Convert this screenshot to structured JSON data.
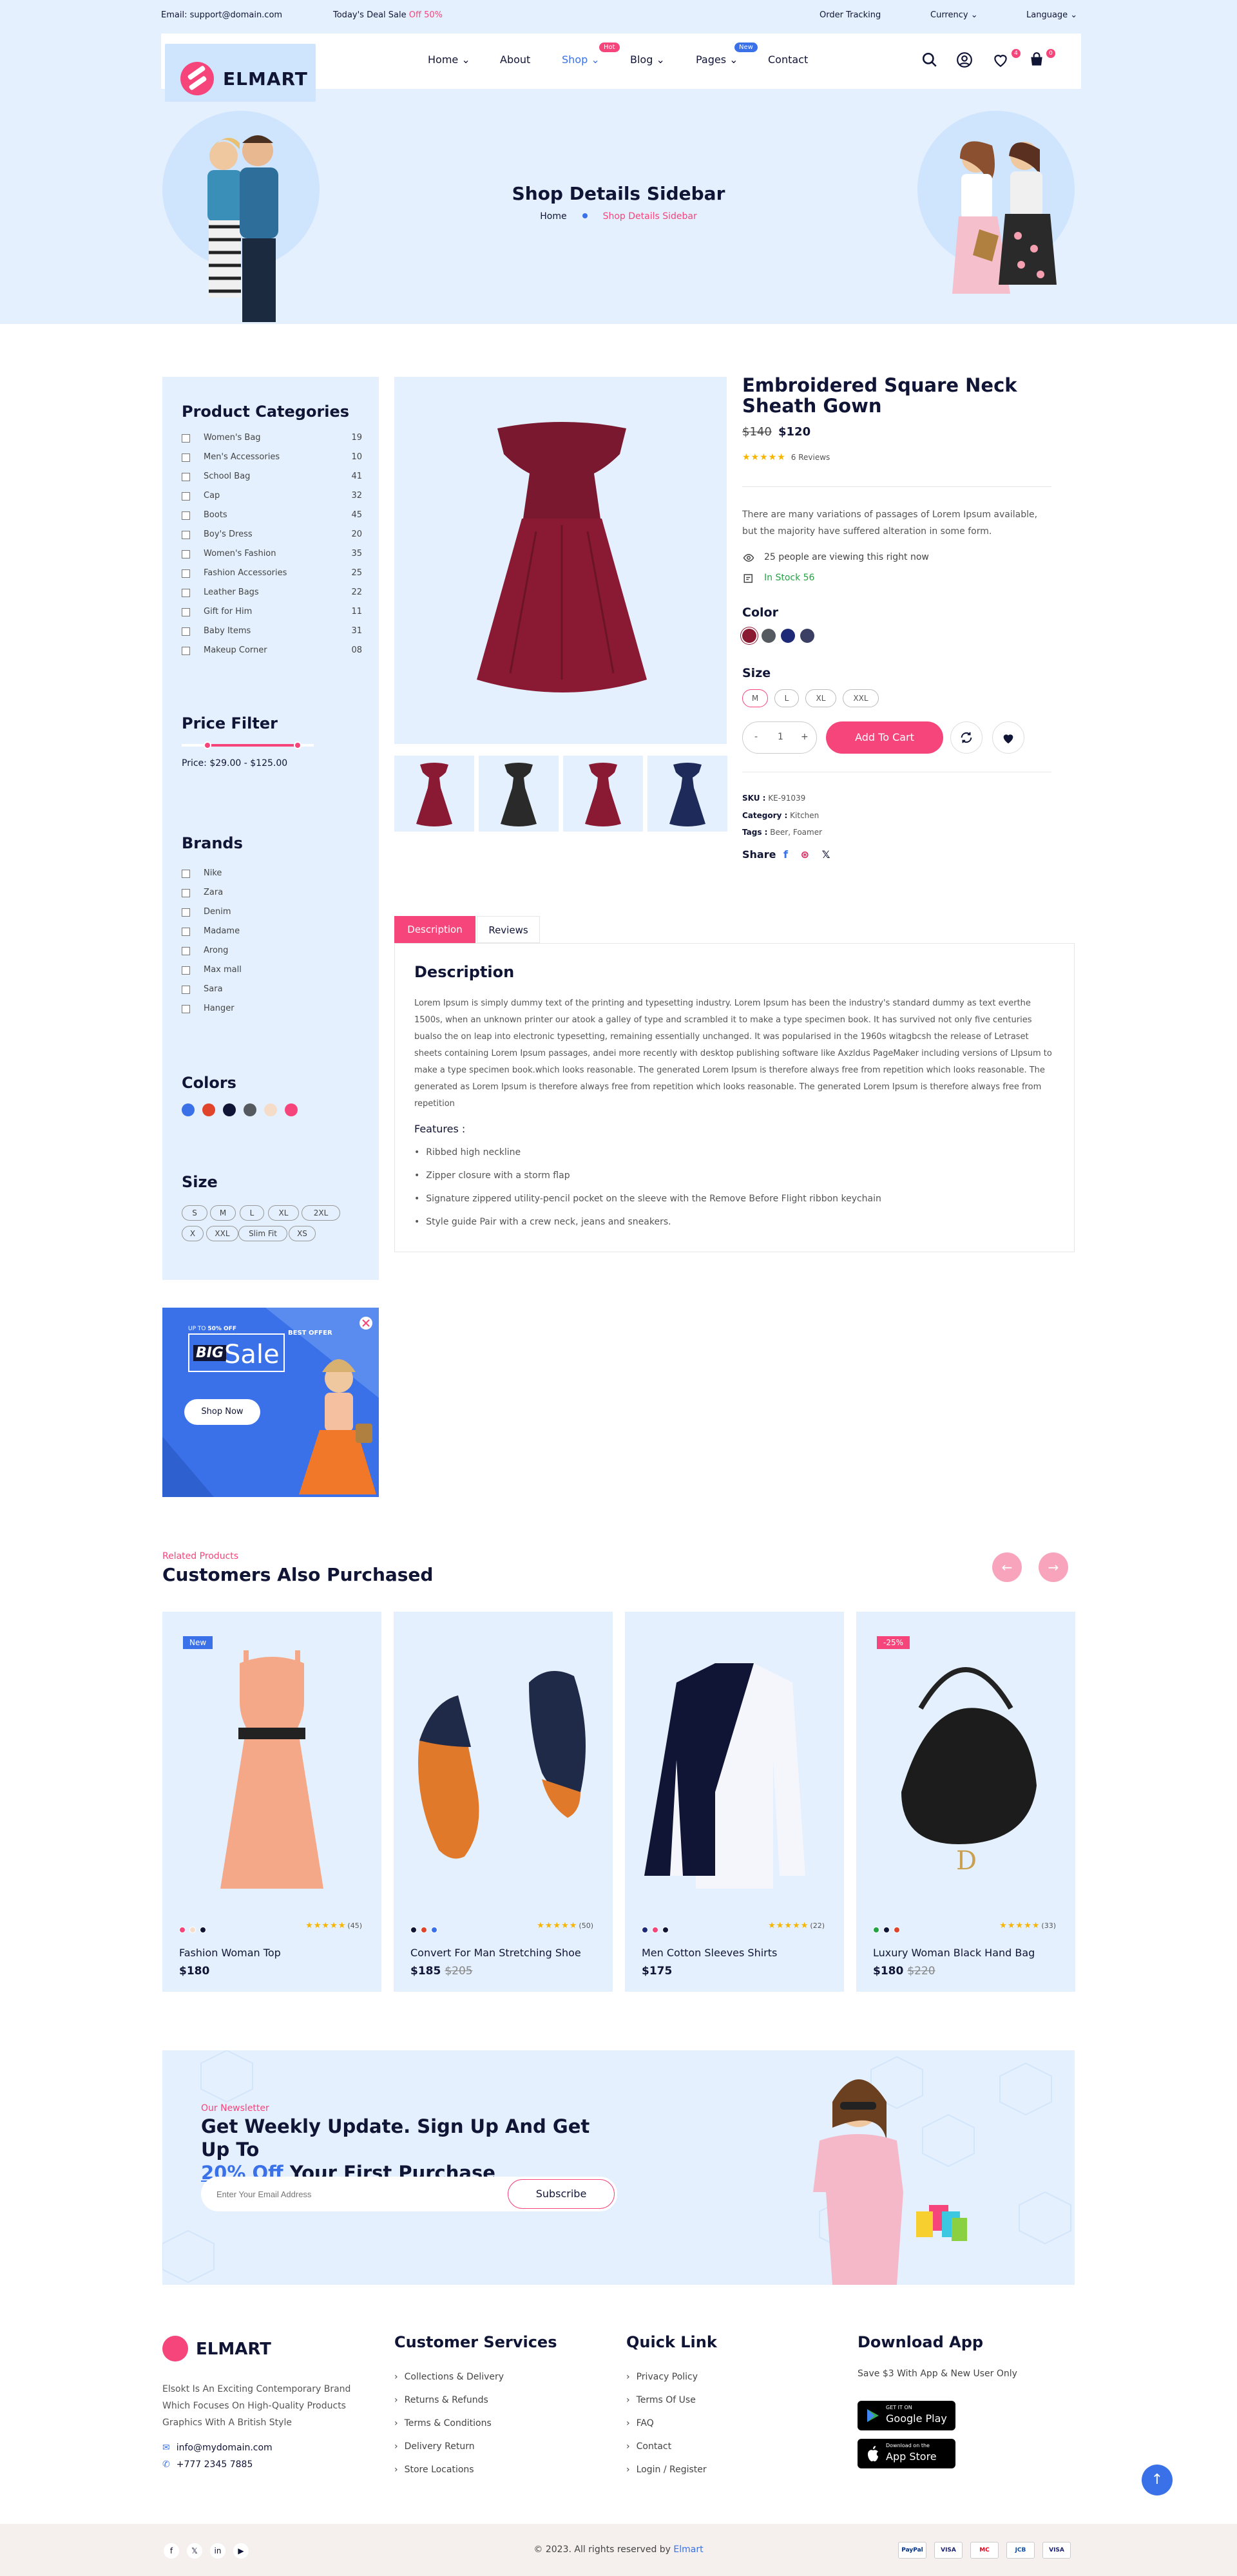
{
  "topbar": {
    "email": "Email: support@domain.com",
    "deal_prefix": "Today's Deal Sale",
    "deal_highlight": "Off 50%",
    "order_tracking": "Order Tracking",
    "currency": "Currency",
    "language": "Language"
  },
  "logo": {
    "text": "ELMART"
  },
  "nav": {
    "items": [
      "Home",
      "About",
      "Shop",
      "Blog",
      "Pages",
      "Contact"
    ],
    "hot_badge": "Hot",
    "new_badge": "New",
    "wishlist_count": "4",
    "cart_count": "0"
  },
  "hero": {
    "title": "Shop Details Sidebar",
    "crumb_home": "Home",
    "crumb_current": "Shop Details Sidebar"
  },
  "sidebar": {
    "categories_title": "Product Categories",
    "categories": [
      {
        "name": "Women's Bag",
        "count": "19"
      },
      {
        "name": "Men's Accessories",
        "count": "10"
      },
      {
        "name": "School Bag",
        "count": "41"
      },
      {
        "name": "Cap",
        "count": "32"
      },
      {
        "name": "Boots",
        "count": "45"
      },
      {
        "name": "Boy's Dress",
        "count": "20"
      },
      {
        "name": "Women's Fashion",
        "count": "35"
      },
      {
        "name": "Fashion Accessories",
        "count": "25"
      },
      {
        "name": "Leather Bags",
        "count": "22"
      },
      {
        "name": "Gift for Him",
        "count": "11"
      },
      {
        "name": "Baby Items",
        "count": "31"
      },
      {
        "name": "Makeup Corner",
        "count": "08"
      }
    ],
    "price_title": "Price Filter",
    "price_text": "Price: $29.00  - $125.00",
    "brands_title": "Brands",
    "brands": [
      "Nike",
      "Zara",
      "Denim",
      "Madame",
      "Arong",
      "Max mall",
      "Sara",
      "Hanger"
    ],
    "colors_title": "Colors",
    "colors": [
      "#3b71e8",
      "#e0452b",
      "#101435",
      "#555a60",
      "#f5dcc8",
      "#f5457b"
    ],
    "size_title": "Size",
    "sizes": [
      "S",
      "M",
      "L",
      "XL",
      "2XL",
      "X",
      "XXL",
      "Slim Fit",
      "XS"
    ]
  },
  "banner": {
    "upto": "UP TO",
    "off": "50% OFF",
    "big": "BIG",
    "sale": "Sale",
    "best_offer": "BEST OFFER",
    "button": "Shop Now"
  },
  "product": {
    "name": "Embroidered Square Neck Sheath Gown",
    "old_price": "$140",
    "price": "$120",
    "stars": "★★★★★",
    "reviews": "6 Reviews",
    "description": "There are many variations of passages of Lorem Ipsum available, but the majority have suffered alteration in some form.",
    "viewing": "25 people are viewing this right now",
    "stock": "In Stock 56",
    "color_label": "Color",
    "swatches": [
      "#8a1a33",
      "#555a60",
      "#1e2a78",
      "#3b3f63"
    ],
    "size_label": "Size",
    "sizes": [
      "M",
      "L",
      "XL",
      "XXL"
    ],
    "qty": "1",
    "qty_minus": "-",
    "qty_plus": "+",
    "add_to_cart": "Add To Cart",
    "sku_label": "SKU :",
    "sku": "KE-91039",
    "category_label": "Category :",
    "category": "Kitchen",
    "tags_label": "Tags :",
    "tags": "Beer, Foamer",
    "share_label": "Share"
  },
  "tabs": {
    "description_tab": "Description",
    "reviews_tab": "Reviews",
    "desc_title": "Description",
    "desc_text": "Lorem Ipsum is simply dummy text of the printing and typesetting industry. Lorem Ipsum has been the industry's standard dummy as text everthe 1500s, when an unknown printer our atook a galley of type and scrambled it to make a type specimen book. It has survived not only five centuries bualso the on leap into electronic typesetting, remaining essentially unchanged. It was popularised in the 1960s witagbcsh the release of Letraset sheets containing Lorem Ipsum passages, andei more recently with desktop publishing software like Axzldus PageMaker including versions of LIpsum to make a type specimen book.which looks reasonable. The generated Lorem Ipsum is therefore always free from repetition which looks reasonable. The generated as Lorem Ipsum is therefore always free from repetition which looks reasonable. The generated Lorem Ipsum is therefore always free from repetition",
    "features_title": "Features :",
    "features": [
      "Ribbed high neckline",
      "Zipper closure with a storm flap",
      "Signature zippered utility-pencil pocket on the sleeve with the Remove Before Flight ribbon keychain",
      "Style guide Pair with a crew neck, jeans and sneakers."
    ]
  },
  "related": {
    "subtitle": "Related Products",
    "title": "Customers Also Purchased",
    "prev": "←",
    "next": "→",
    "products": [
      {
        "tag": "New",
        "tag_color": "#3b71e8",
        "name": "Fashion Woman Top",
        "price": "$180",
        "old_price": "",
        "reviews": "(45)",
        "dots": [
          "#f5457b",
          "#f5dcc8",
          "#101435"
        ]
      },
      {
        "tag": "",
        "tag_color": "",
        "name": "Convert For Man Stretching Shoe",
        "price": "$185",
        "old_price": "$205",
        "reviews": "(50)",
        "dots": [
          "#101435",
          "#e0452b",
          "#3b71e8"
        ]
      },
      {
        "tag": "",
        "tag_color": "",
        "name": "Men Cotton Sleeves Shirts",
        "price": "$175",
        "old_price": "",
        "reviews": "(22)",
        "dots": [
          "#1e2a78",
          "#f5457b",
          "#101435"
        ]
      },
      {
        "tag": "-25%",
        "tag_color": "#f5457b",
        "name": "Luxury Woman Black Hand Bag",
        "price": "$180",
        "old_price": "$220",
        "reviews": "(33)",
        "dots": [
          "#25a244",
          "#101435",
          "#e0452b"
        ]
      }
    ],
    "stars": "★★★★★"
  },
  "newsletter": {
    "subtitle": "Our Newsletter",
    "title_1": "Get Weekly Update. Sign Up And Get Up To",
    "title_highlight": "20% Off",
    "title_2": "Your First Purchase",
    "placeholder": "Enter Your Email Address",
    "button": "Subscribe"
  },
  "footer": {
    "about": "Elsokt Is An Exciting Contemporary Brand Which Focuses On High-Quality Products Graphics With A British Style",
    "email": "info@mydomain.com",
    "phone": "+777 2345 7885",
    "services_title": "Customer Services",
    "services": [
      "Collections & Delivery",
      "Returns & Refunds",
      "Terms & Conditions",
      "Delivery Return",
      "Store Locations"
    ],
    "quick_title": "Quick Link",
    "quick": [
      "Privacy Policy",
      "Terms Of Use",
      "FAQ",
      "Contact",
      "Login / Register"
    ],
    "app_title": "Download App",
    "app_text": "Save $3 With App & New User Only",
    "google_small": "GET IT ON",
    "google_big": "Google Play",
    "apple_small": "Download on the",
    "apple_big": "App Store",
    "copyright": "© 2023. All rights reserved by",
    "brand": "Elmart",
    "social": [
      "f",
      "𝕏",
      "in",
      "▶"
    ],
    "payments": [
      "PayPal",
      "VISA",
      "MC",
      "JCB",
      "VISA"
    ]
  }
}
